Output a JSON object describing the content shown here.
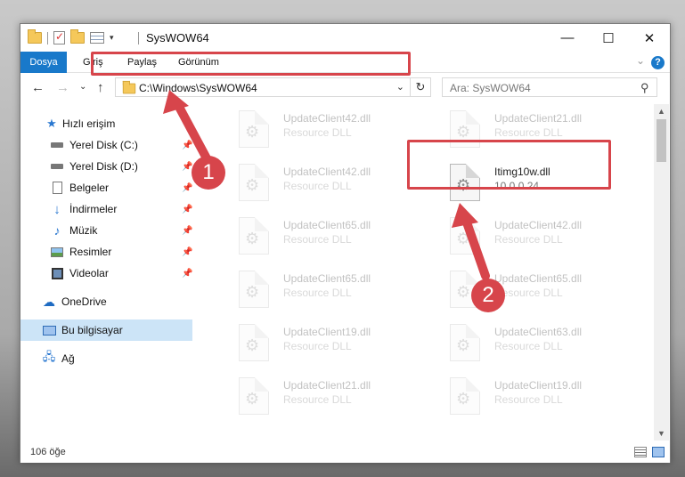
{
  "window": {
    "title": "SysWOW64",
    "min_icon": "minimize-icon",
    "max_icon": "maximize-icon",
    "close_icon": "close-icon"
  },
  "ribbon": {
    "tabs": [
      "Dosya",
      "Giriş",
      "Paylaş",
      "Görünüm"
    ],
    "active_tab_color": "#1979ca",
    "help_label": "?"
  },
  "navigation": {
    "address": "C:\\Windows\\SysWOW64",
    "search_placeholder": "Ara: SysWOW64"
  },
  "sidebar": {
    "items": [
      {
        "label": "Hızlı erişim",
        "icon": "star-icon"
      },
      {
        "label": "Yerel Disk (C:)",
        "icon": "drive-icon",
        "pinned": true
      },
      {
        "label": "Yerel Disk (D:)",
        "icon": "drive-icon",
        "pinned": true
      },
      {
        "label": "Belgeler",
        "icon": "documents-icon",
        "pinned": true
      },
      {
        "label": "İndirmeler",
        "icon": "download-icon",
        "pinned": true
      },
      {
        "label": "Müzik",
        "icon": "music-icon",
        "pinned": true
      },
      {
        "label": "Resimler",
        "icon": "pictures-icon",
        "pinned": true
      },
      {
        "label": "Videolar",
        "icon": "videos-icon",
        "pinned": true
      },
      {
        "label": "OneDrive",
        "icon": "cloud-icon"
      },
      {
        "label": "Bu bilgisayar",
        "icon": "computer-icon",
        "selected": true
      },
      {
        "label": "Ağ",
        "icon": "network-icon"
      }
    ]
  },
  "files": [
    {
      "name": "UpdateClient42.dll",
      "type": "Resource DLL",
      "faded": true
    },
    {
      "name": "UpdateClient21.dll",
      "type": "Resource DLL",
      "faded": true
    },
    {
      "name": "UpdateClient42.dll",
      "type": "Resource DLL",
      "faded": true
    },
    {
      "name": "Itimg10w.dll",
      "type": "10.0.0.24",
      "faded": false
    },
    {
      "name": "UpdateClient65.dll",
      "type": "Resource DLL",
      "faded": true
    },
    {
      "name": "UpdateClient42.dll",
      "type": "Resource DLL",
      "faded": true
    },
    {
      "name": "UpdateClient65.dll",
      "type": "Resource DLL",
      "faded": true
    },
    {
      "name": "UpdateClient65.dll",
      "type": "Resource DLL",
      "faded": true
    },
    {
      "name": "UpdateClient19.dll",
      "type": "Resource DLL",
      "faded": true
    },
    {
      "name": "UpdateClient63.dll",
      "type": "Resource DLL",
      "faded": true
    },
    {
      "name": "UpdateClient21.dll",
      "type": "Resource DLL",
      "faded": true
    },
    {
      "name": "UpdateClient19.dll",
      "type": "Resource DLL",
      "faded": true
    }
  ],
  "status": {
    "item_count": "106 öğe"
  },
  "annotations": {
    "callout_1": "1",
    "callout_2": "2",
    "color": "#d7454b"
  }
}
